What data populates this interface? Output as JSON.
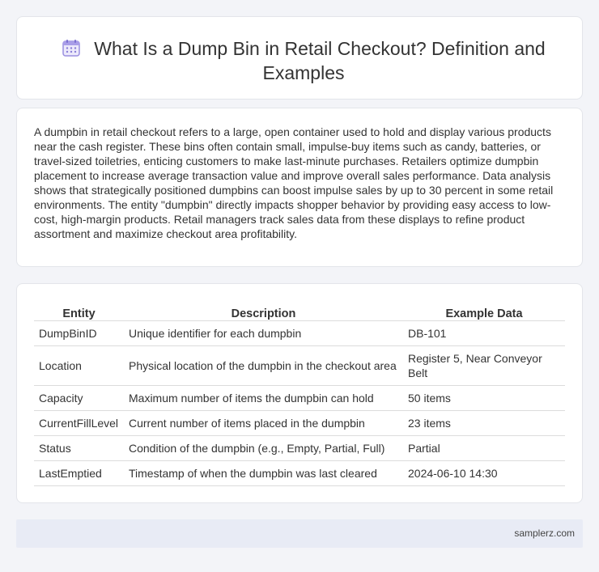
{
  "header": {
    "icon": "calendar-icon",
    "title": "What Is a Dump Bin in Retail Checkout? Definition and Examples"
  },
  "intro": {
    "text": "A dumpbin in retail checkout refers to a large, open container used to hold and display various products near the cash register. These bins often contain small, impulse-buy items such as candy, batteries, or travel-sized toiletries, enticing customers to make last-minute purchases. Retailers optimize dumpbin placement to increase average transaction value and improve overall sales performance. Data analysis shows that strategically positioned dumpbins can boost impulse sales by up to 30 percent in some retail environments. The entity \"dumpbin\" directly impacts shopper behavior by providing easy access to low-cost, high-margin products. Retail managers track sales data from these displays to refine product assortment and maximize checkout area profitability."
  },
  "table": {
    "headers": [
      "Entity",
      "Description",
      "Example Data"
    ],
    "rows": [
      [
        "DumpBinID",
        "Unique identifier for each dumpbin",
        "DB-101"
      ],
      [
        "Location",
        "Physical location of the dumpbin in the checkout area",
        "Register 5, Near Conveyor Belt"
      ],
      [
        "Capacity",
        "Maximum number of items the dumpbin can hold",
        "50 items"
      ],
      [
        "CurrentFillLevel",
        "Current number of items placed in the dumpbin",
        "23 items"
      ],
      [
        "Status",
        "Condition of the dumpbin (e.g., Empty, Partial, Full)",
        "Partial"
      ],
      [
        "LastEmptied",
        "Timestamp of when the dumpbin was last cleared",
        "2024-06-10 14:30"
      ]
    ]
  },
  "footer": {
    "site": "samplerz.com"
  },
  "colors": {
    "page_background": "#f3f4f8",
    "card_background": "#ffffff",
    "footer_background": "#e8ebf5",
    "icon_accent": "#8b7fd8"
  }
}
